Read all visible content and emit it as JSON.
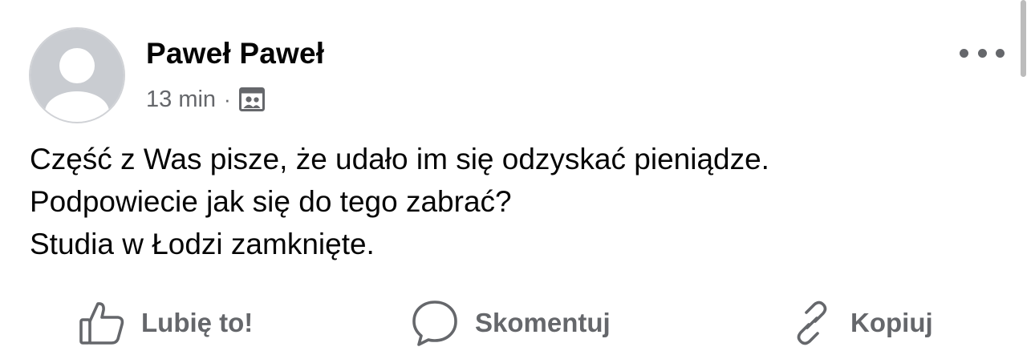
{
  "post": {
    "author": "Paweł Paweł",
    "time": "13 min",
    "separator": "·",
    "audience_icon": "group-audience-icon",
    "more_icon": "more-horizontal-icon",
    "lines": [
      "Część z Was pisze, że udało im się odzyskać pieniądze.",
      "Podpowiecie jak się do tego zabrać?",
      "Studia w Łodzi zamknięte."
    ]
  },
  "actions": {
    "like": {
      "label": "Lubię to!",
      "icon": "thumbs-up-icon"
    },
    "comment": {
      "label": "Skomentuj",
      "icon": "comment-bubble-icon"
    },
    "copy": {
      "label": "Kopiuj",
      "icon": "link-icon"
    }
  },
  "colors": {
    "text": "#050505",
    "secondary": "#65676b",
    "avatar_bg": "#c9ccd1",
    "background": "#ffffff"
  }
}
